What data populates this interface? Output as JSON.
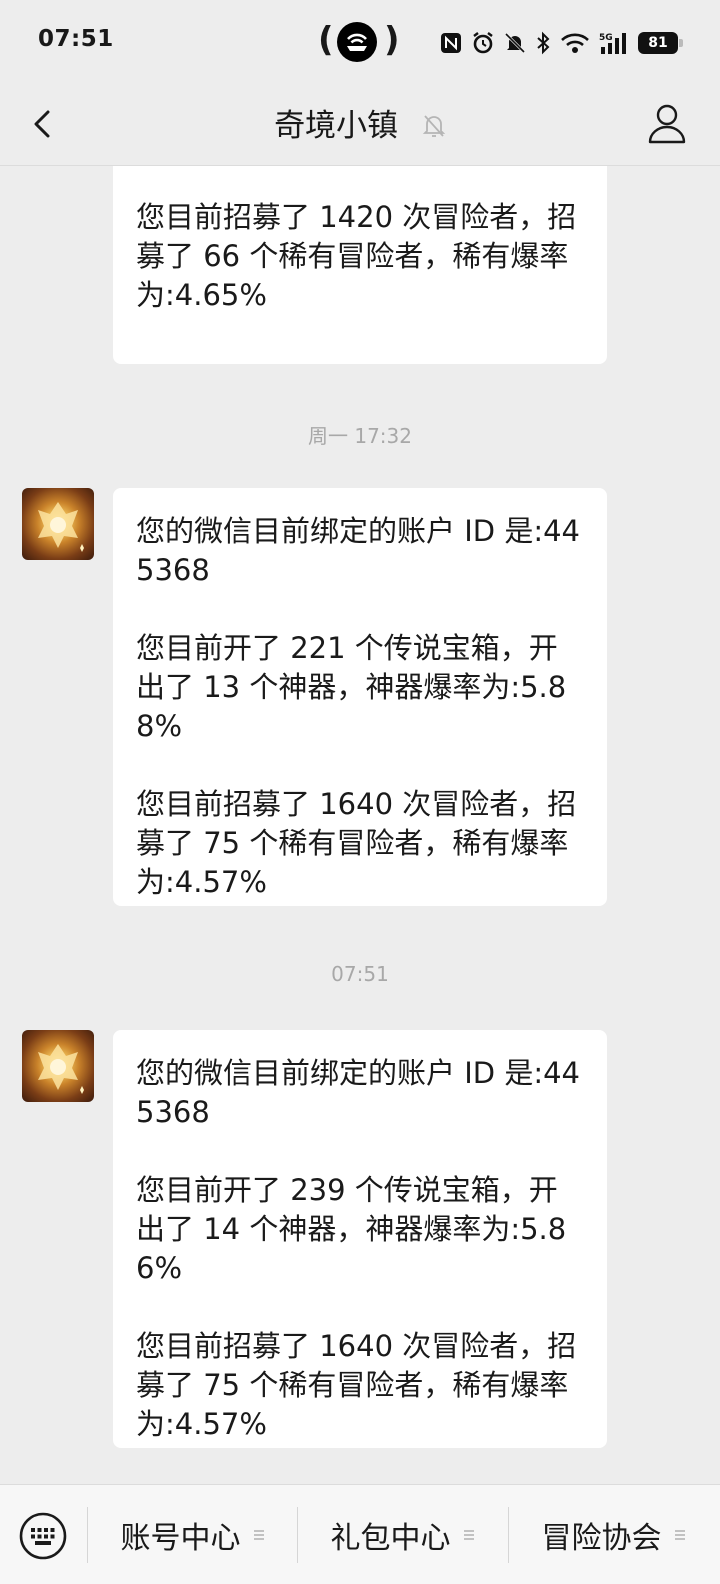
{
  "status_bar": {
    "time": "07:51",
    "battery": "81",
    "icons": [
      "hotspot-icon",
      "nfc-icon",
      "alarm-icon",
      "mute-icon",
      "bluetooth-icon",
      "wifi-icon",
      "5g-signal-icon",
      "battery-icon"
    ]
  },
  "nav": {
    "title": "奇境小镇",
    "back_icon": "chevron-left-icon",
    "mute_icon": "bell-off-icon",
    "profile_icon": "person-icon"
  },
  "messages": [
    {
      "paragraphs": [
        "您目前招募了 1420 次冒险者，招募了 66 个稀有冒险者，稀有爆率为:4.65%"
      ],
      "partial": true
    },
    {
      "timestamp": "周一 17:32",
      "paragraphs": [
        "您的微信目前绑定的账户 ID 是:445368",
        "您目前开了 221 个传说宝箱，开出了 13 个神器，神器爆率为:5.88%",
        "您目前招募了 1640 次冒险者，招募了 75 个稀有冒险者，稀有爆率为:4.57%"
      ]
    },
    {
      "timestamp": "07:51",
      "paragraphs": [
        "您的微信目前绑定的账户 ID 是:445368",
        "您目前开了 239 个传说宝箱，开出了 14 个神器，神器爆率为:5.86%",
        "您目前招募了 1640 次冒险者，招募了 75 个稀有冒险者，稀有爆率为:4.57%"
      ]
    }
  ],
  "menu": {
    "keyboard_icon": "keyboard-icon",
    "items": [
      "账号中心",
      "礼包中心",
      "冒险协会"
    ],
    "item_icon": "menu-lines-icon"
  },
  "colors": {
    "background": "#ededed",
    "bubble": "#ffffff",
    "avatar_gold": "#f2c35a"
  }
}
